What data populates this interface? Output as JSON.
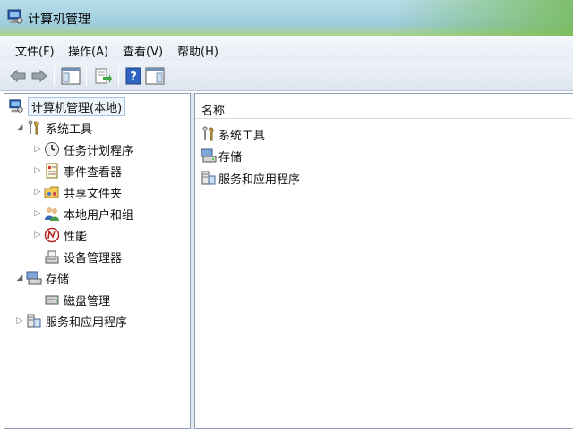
{
  "window": {
    "title": "计算机管理"
  },
  "menu": [
    {
      "label": "文件(F)"
    },
    {
      "label": "操作(A)"
    },
    {
      "label": "查看(V)"
    },
    {
      "label": "帮助(H)"
    }
  ],
  "toolbar": {
    "icons": [
      "back-arrow-icon",
      "forward-arrow-icon",
      "show-hide-tree-icon",
      "export-list-icon",
      "help-icon",
      "show-hide-action-pane-icon"
    ]
  },
  "tree": {
    "root": {
      "label": "计算机管理(本地)",
      "icon": "computer-management-icon"
    },
    "items": [
      {
        "label": "系统工具",
        "icon": "tools-icon",
        "expander": "expanded"
      },
      {
        "label": "任务计划程序",
        "icon": "clock-icon",
        "expander": "collapsed"
      },
      {
        "label": "事件查看器",
        "icon": "event-viewer-icon",
        "expander": "collapsed"
      },
      {
        "label": "共享文件夹",
        "icon": "shared-folder-icon",
        "expander": "collapsed"
      },
      {
        "label": "本地用户和组",
        "icon": "users-icon",
        "expander": "collapsed"
      },
      {
        "label": "性能",
        "icon": "performance-icon",
        "expander": "collapsed"
      },
      {
        "label": "设备管理器",
        "icon": "device-manager-icon",
        "expander": "none"
      },
      {
        "label": "存储",
        "icon": "storage-icon",
        "expander": "expanded"
      },
      {
        "label": "磁盘管理",
        "icon": "disk-icon",
        "expander": "none"
      },
      {
        "label": "服务和应用程序",
        "icon": "services-icon",
        "expander": "collapsed"
      }
    ]
  },
  "details": {
    "column_header": "名称",
    "rows": [
      {
        "label": "系统工具",
        "icon": "tools-icon"
      },
      {
        "label": "存储",
        "icon": "storage-icon"
      },
      {
        "label": "服务和应用程序",
        "icon": "services-icon"
      }
    ]
  },
  "colors": {
    "title_glass": "#a9d3e2",
    "aero_green": "#76ba54",
    "selection_border": "#a9c3e0"
  }
}
